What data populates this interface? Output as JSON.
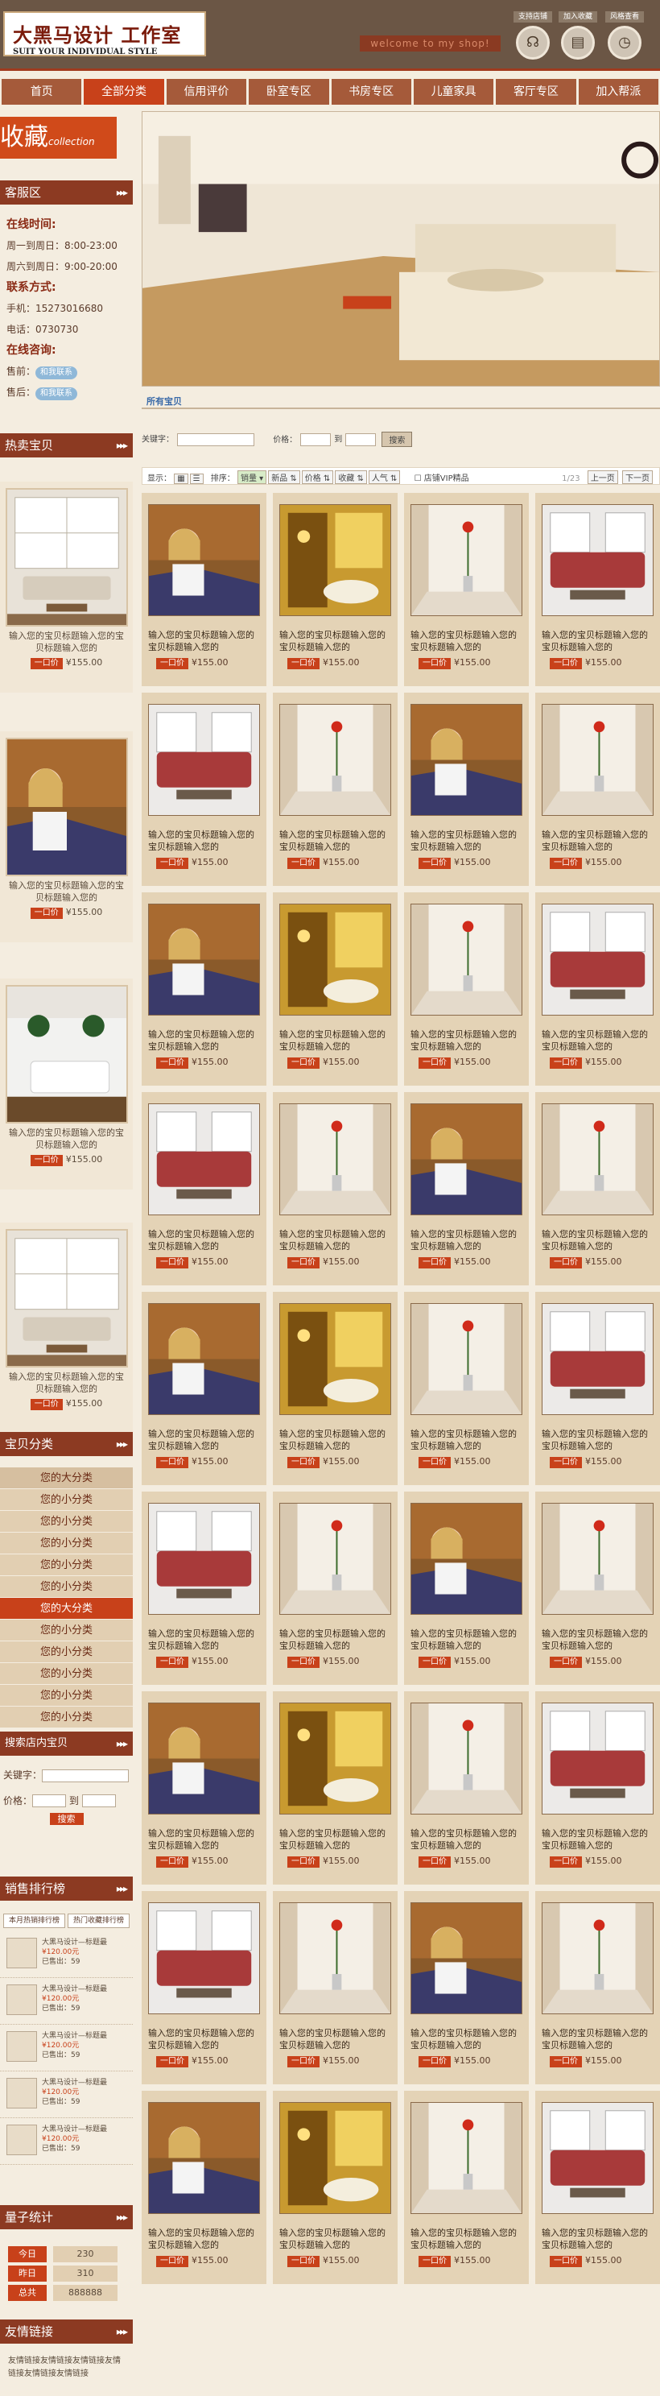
{
  "header": {
    "logo_title": "大黑马设计 工作室",
    "logo_sub": "SUIT YOUR INDIVIDUAL STYLE",
    "welcome": "welcome to my shop!",
    "buttons": [
      {
        "label": "支持店铺",
        "icon": "mouse-icon"
      },
      {
        "label": "加入收藏",
        "icon": "document-icon"
      },
      {
        "label": "风格查看",
        "icon": "clock-icon"
      }
    ]
  },
  "nav": [
    "首页",
    "全部分类",
    "信用评价",
    "卧室专区",
    "书房专区",
    "儿童家具",
    "客厅专区",
    "加入帮派"
  ],
  "nav_active": 1,
  "favorite": {
    "main": "收藏",
    "sub": "collection"
  },
  "service": {
    "title": "客服区",
    "hours_title": "在线时间:",
    "hours": [
      "周一到周日：8:00-23:00",
      "周六到周日：9:00-20:00"
    ],
    "contact_title": "联系方式:",
    "phone": "手机：15273016680",
    "tel": "电话：0730730",
    "consult_title": "在线咨询:",
    "pre_label": "售前：",
    "post_label": "售后：",
    "qq_label": "和我联系"
  },
  "hot": {
    "title": "热卖宝贝",
    "items": [
      {
        "scene": "living",
        "title": "输入您的宝贝标题输入您的宝贝标题输入您的",
        "tag": "一口价",
        "price": "¥155.00"
      },
      {
        "scene": "woman",
        "title": "输入您的宝贝标题输入您的宝贝标题输入您的",
        "tag": "一口价",
        "price": "¥155.00"
      },
      {
        "scene": "white-sofa",
        "title": "输入您的宝贝标题输入您的宝贝标题输入您的",
        "tag": "一口价",
        "price": "¥155.00"
      },
      {
        "scene": "living",
        "title": "输入您的宝贝标题输入您的宝贝标题输入您的",
        "tag": "一口价",
        "price": "¥155.00"
      }
    ]
  },
  "categories": {
    "title": "宝贝分类",
    "items": [
      {
        "label": "您的大分类",
        "type": "big2"
      },
      {
        "label": "您的小分类",
        "type": "small"
      },
      {
        "label": "您的小分类",
        "type": "small"
      },
      {
        "label": "您的小分类",
        "type": "small"
      },
      {
        "label": "您的小分类",
        "type": "small"
      },
      {
        "label": "您的小分类",
        "type": "small"
      },
      {
        "label": "您的大分类",
        "type": "big"
      },
      {
        "label": "您的小分类",
        "type": "small"
      },
      {
        "label": "您的小分类",
        "type": "small"
      },
      {
        "label": "您的小分类",
        "type": "small"
      },
      {
        "label": "您的小分类",
        "type": "small"
      },
      {
        "label": "您的小分类",
        "type": "small"
      }
    ]
  },
  "shop_search": {
    "title": "搜索店内宝贝",
    "keyword": "关键字：",
    "price": "价格：",
    "to": "到",
    "button": "搜索"
  },
  "ranking": {
    "title": "销售排行榜",
    "tabs": [
      "本月热销排行榜",
      "热门收藏排行榜"
    ],
    "items": [
      {
        "name": "大黑马设计—标题最",
        "price": "¥120.00元",
        "sold": "已售出：59"
      },
      {
        "name": "大黑马设计—标题最",
        "price": "¥120.00元",
        "sold": "已售出：59"
      },
      {
        "name": "大黑马设计—标题最",
        "price": "¥120.00元",
        "sold": "已售出：59"
      },
      {
        "name": "大黑马设计—标题最",
        "price": "¥120.00元",
        "sold": "已售出：59"
      },
      {
        "name": "大黑马设计—标题最",
        "price": "¥120.00元",
        "sold": "已售出：59"
      }
    ]
  },
  "stats": {
    "title": "量子统计",
    "rows": [
      {
        "k": "今日",
        "v": "230"
      },
      {
        "k": "昨日",
        "v": "310"
      },
      {
        "k": "总共",
        "v": "888888"
      }
    ]
  },
  "links": {
    "title": "友情链接",
    "text": "友情链接友情链接友情链接友情链接友情链接友情链接"
  },
  "main": {
    "breadcrumb": "所有宝贝",
    "search": {
      "keyword": "关键字：",
      "price": "价格：",
      "to": "到",
      "button": "搜索"
    },
    "sort": {
      "show": "显示：",
      "sort": "排序：",
      "options": [
        "销量",
        "新品",
        "价格",
        "收藏",
        "人气"
      ],
      "vip": "店铺VIP精品",
      "page": "1/23",
      "prev": "上一页",
      "next": "下一页"
    },
    "product_title": "输入您的宝贝标题输入您的宝贝标题输入您的",
    "product_tag": "一口价",
    "product_price": "¥155.00",
    "grid": [
      "woman",
      "lamp",
      "vase",
      "sofa",
      "sofa",
      "vase",
      "woman",
      "vase",
      "woman",
      "lamp",
      "vase",
      "sofa",
      "sofa",
      "vase",
      "woman",
      "vase",
      "woman",
      "lamp",
      "vase",
      "sofa",
      "sofa",
      "vase",
      "woman",
      "vase",
      "woman",
      "lamp",
      "vase",
      "sofa",
      "sofa",
      "vase",
      "woman",
      "vase",
      "woman",
      "lamp",
      "vase",
      "sofa"
    ]
  },
  "colors": {
    "header": "#6b5645",
    "accent": "#c8411a",
    "nav": "#a55a3a",
    "card": "#e4d3b6"
  }
}
